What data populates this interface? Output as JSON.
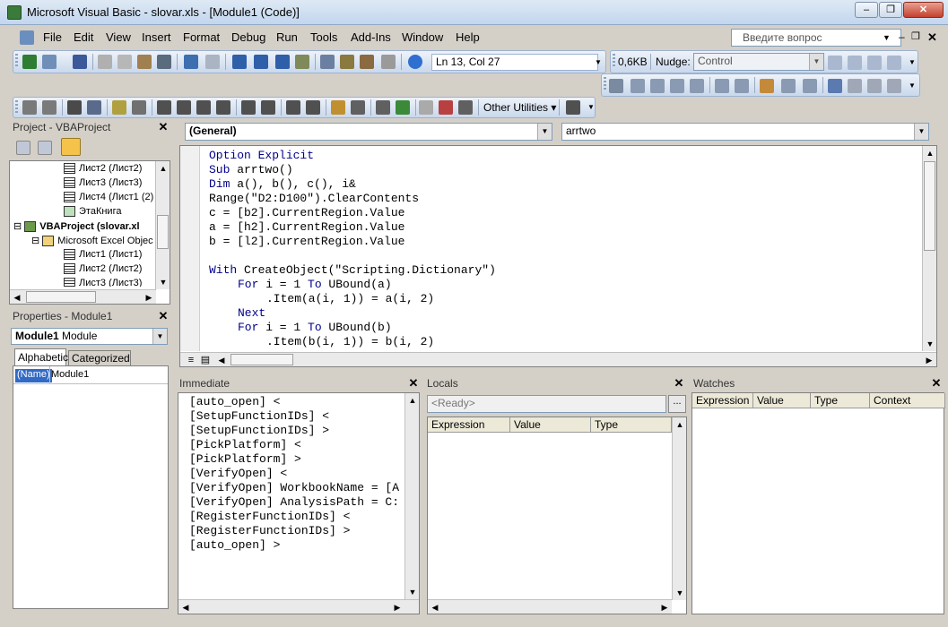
{
  "window": {
    "title": "Microsoft Visual Basic - slovar.xls - [Module1 (Code)]"
  },
  "menu": {
    "items": [
      "File",
      "Edit",
      "View",
      "Insert",
      "Format",
      "Debug",
      "Run",
      "Tools",
      "Add-Ins",
      "Window",
      "Help"
    ],
    "ask_placeholder": "Введите вопрос"
  },
  "toolbar": {
    "position": "Ln 13, Col 27",
    "size": "0,6KB",
    "nudge_label": "Nudge:",
    "control_value": "Control",
    "other_utilities": "Other Utilities"
  },
  "project": {
    "title": "Project - VBAProject",
    "tree": [
      {
        "label": "Лист2 (Лист2)",
        "indent": 4,
        "icon": "sheet-icon"
      },
      {
        "label": "Лист3 (Лист3)",
        "indent": 4,
        "icon": "sheet-icon"
      },
      {
        "label": "Лист4 (Лист1 (2)",
        "indent": 4,
        "icon": "sheet-icon"
      },
      {
        "label": "ЭтаКнига",
        "indent": 4,
        "icon": "workbook-icon"
      },
      {
        "label": "VBAProject (slovar.xl",
        "indent": 0,
        "icon": "vbaproject-icon",
        "bold": true
      },
      {
        "label": "Microsoft Excel Objec",
        "indent": 2,
        "icon": "folder-icon"
      },
      {
        "label": "Лист1 (Лист1)",
        "indent": 4,
        "icon": "sheet-icon"
      },
      {
        "label": "Лист2 (Лист2)",
        "indent": 4,
        "icon": "sheet-icon"
      },
      {
        "label": "Лист3 (Лист3)",
        "indent": 4,
        "icon": "sheet-icon"
      }
    ]
  },
  "properties": {
    "title": "Properties - Module1",
    "object_name": "Module1",
    "object_type": "Module",
    "tabs": [
      "Alphabetic",
      "Categorized"
    ],
    "rows": [
      {
        "name": "(Name)",
        "value": "Module1"
      }
    ]
  },
  "code": {
    "object_combo": "(General)",
    "proc_combo": "arrtwo",
    "lines": [
      {
        "indent": 0,
        "parts": [
          {
            "t": "Option Explicit",
            "k": true
          }
        ]
      },
      {
        "indent": 0,
        "parts": [
          {
            "t": "Sub",
            "k": true
          },
          {
            "t": " arrtwo()"
          }
        ]
      },
      {
        "indent": 0,
        "parts": [
          {
            "t": "Dim",
            "k": true
          },
          {
            "t": " a(), b(), c(), i&"
          }
        ]
      },
      {
        "indent": 0,
        "parts": [
          {
            "t": "Range(\"D2:D100\").ClearContents"
          }
        ]
      },
      {
        "indent": 0,
        "parts": [
          {
            "t": "c = [b2].CurrentRegion.Value"
          }
        ]
      },
      {
        "indent": 0,
        "parts": [
          {
            "t": "a = [h2].CurrentRegion.Value"
          }
        ]
      },
      {
        "indent": 0,
        "parts": [
          {
            "t": "b = [l2].CurrentRegion.Value"
          }
        ]
      },
      {
        "indent": 0,
        "parts": []
      },
      {
        "indent": 0,
        "parts": [
          {
            "t": "With",
            "k": true
          },
          {
            "t": " CreateObject(\"Scripting.Dictionary\")"
          }
        ]
      },
      {
        "indent": 1,
        "parts": [
          {
            "t": "For",
            "k": true
          },
          {
            "t": " i = 1 "
          },
          {
            "t": "To",
            "k": true
          },
          {
            "t": " UBound(a)"
          }
        ]
      },
      {
        "indent": 2,
        "parts": [
          {
            "t": ".Item(a(i, 1)) = a(i, 2)"
          }
        ]
      },
      {
        "indent": 1,
        "parts": [
          {
            "t": "Next",
            "k": true
          }
        ]
      },
      {
        "indent": 1,
        "parts": [
          {
            "t": "For",
            "k": true
          },
          {
            "t": " i = 1 "
          },
          {
            "t": "To",
            "k": true
          },
          {
            "t": " UBound(b)"
          }
        ]
      },
      {
        "indent": 2,
        "parts": [
          {
            "t": ".Item(b(i, 1)) = b(i, 2)"
          }
        ]
      }
    ]
  },
  "immediate": {
    "title": "Immediate",
    "lines": [
      "[auto_open] <",
      "[SetupFunctionIDs] <",
      "[SetupFunctionIDs] >",
      "[PickPlatform] <",
      "[PickPlatform] >",
      "[VerifyOpen] <",
      "[VerifyOpen] WorkbookName = [A",
      "[VerifyOpen] AnalysisPath = C:",
      "[RegisterFunctionIDs] <",
      "[RegisterFunctionIDs] >",
      "[auto_open] >"
    ]
  },
  "locals": {
    "title": "Locals",
    "context": "<Ready>",
    "ellipsis": "...",
    "columns": [
      "Expression",
      "Value",
      "Type"
    ]
  },
  "watches": {
    "title": "Watches",
    "columns": [
      "Expression",
      "Value",
      "Type",
      "Context"
    ]
  },
  "colors": {
    "keyword": "#00008b",
    "titlebar": "#c2d6ee"
  }
}
